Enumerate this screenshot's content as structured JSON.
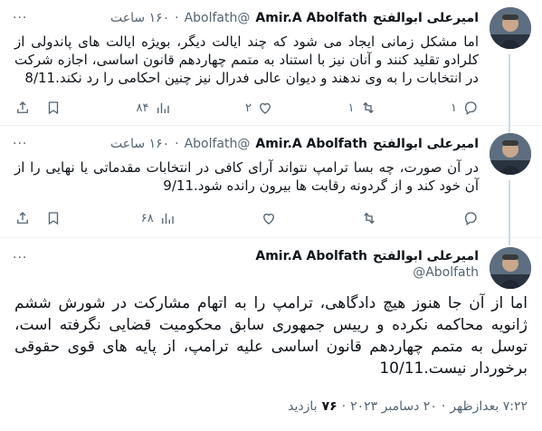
{
  "tweets": [
    {
      "name_fa": "امیرعلی ابوالفتح",
      "name_en": "Amir.A Abolfath",
      "handle": "@Abolfath",
      "time": "۱۶۰ ساعت",
      "text": "اما مشکل زمانی ایجاد می شود که چند ایالت دیگر، بویژه ایالت های پاندولی از کلرادو تقلید کنند و آنان نیز با استناد به متمم چهاردهم قانون اساسی، اجازه شرکت در انتخابات را به وی ندهند و دیوان عالی فدرال نیز چنین احکامی را رد نکند.8/11",
      "replies": "۱",
      "retweets": "۱",
      "likes": "۲",
      "views": "۸۴"
    },
    {
      "name_fa": "امیرعلی ابوالفتح",
      "name_en": "Amir.A Abolfath",
      "handle": "@Abolfath",
      "time": "۱۶۰ ساعت",
      "text": "در آن صورت، چه بسا ترامپ نتواند آرای کافی در انتخابات مقدماتی یا نهایی را از آن خود کند و از گردونه رقابت ها بیرون رانده شود.9/11",
      "replies": "",
      "retweets": "",
      "likes": "",
      "views": "۶۸"
    }
  ],
  "main_tweet": {
    "name_fa": "امیرعلی ابوالفتح",
    "name_en": "Amir.A Abolfath",
    "handle": "@Abolfath",
    "text": "اما از آن جا هنوز هیچ دادگاهی، ترامپ را به اتهام مشارکت در شورش ششم ژانویه محاکمه نکرده و رییس جمهوری سابق محکومیت قضایی نگرفته است، توسل به متمم چهاردهم قانون اساسی علیه ترامپ، از پایه های قوی حقوقی برخوردار نیست.10/11",
    "time": "۷:۲۲ بعدازظهر",
    "date": "۲۰ دسامبر ۲۰۲۳",
    "views_count": "۷۶",
    "views_label": "بازدید"
  },
  "separator": "·",
  "more_glyph": "···",
  "colors": {
    "text": "#0f1419",
    "muted": "#536471",
    "divider": "#eff3f4",
    "thread": "#cfd9de"
  }
}
